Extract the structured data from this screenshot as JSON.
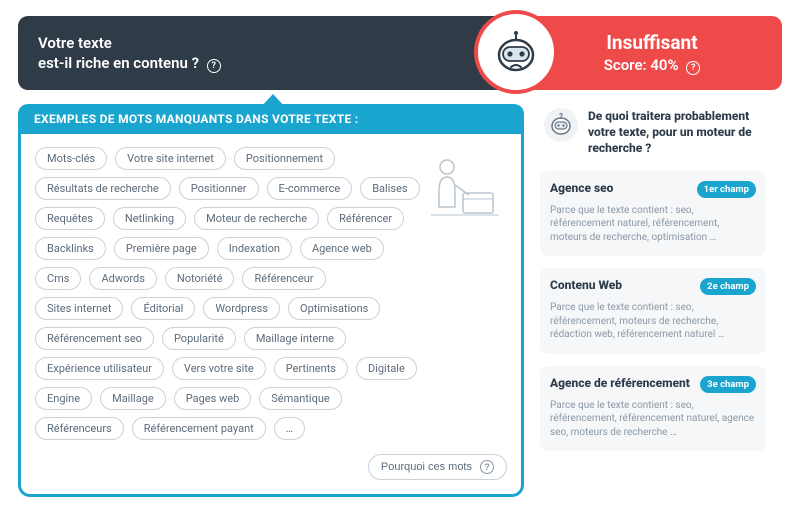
{
  "header": {
    "line1": "Votre texte",
    "line2": "est-il riche en contenu ?",
    "status": "Insuffisant",
    "score_label": "Score: 40%"
  },
  "missing": {
    "title": "EXEMPLES DE MOTS MANQUANTS DANS VOTRE TEXTE :",
    "why_button": "Pourquoi ces mots",
    "tags": [
      "Mots-clés",
      "Votre site internet",
      "Positionnement",
      "Résultats de recherche",
      "Positionner",
      "E-commerce",
      "Balises",
      "Requêtes",
      "Netlinking",
      "Moteur de recherche",
      "Référencer",
      "Backlinks",
      "Première page",
      "Indexation",
      "Agence web",
      "Cms",
      "Adwords",
      "Notoriété",
      "Référenceur",
      "Sites internet",
      "Éditorial",
      "Wordpress",
      "Optimisations",
      "Référencement seo",
      "Popularité",
      "Maillage interne",
      "Expérience utilisateur",
      "Vers votre site",
      "Pertinents",
      "Digitale",
      "Engine",
      "Maillage",
      "Pages web",
      "Sémantique",
      "Référenceurs",
      "Référencement payant",
      "…"
    ]
  },
  "topic": {
    "title": "De quoi traitera probablement votre texte, pour un moteur de recherche ?",
    "fields": [
      {
        "name": "Agence seo",
        "badge": "1er champ",
        "desc": "Parce que le texte contient :   seo, référencement naturel, référencement, moteurs de recherche, optimisation …"
      },
      {
        "name": "Contenu Web",
        "badge": "2e champ",
        "desc": "Parce que le texte contient :   seo, référencement, moteurs de recherche, rédaction web, référencement naturel …"
      },
      {
        "name": "Agence de référencement",
        "badge": "3e champ",
        "desc": "Parce que le texte contient :   seo, référencement, référencement naturel, agence seo, moteurs de recherche …"
      }
    ]
  }
}
